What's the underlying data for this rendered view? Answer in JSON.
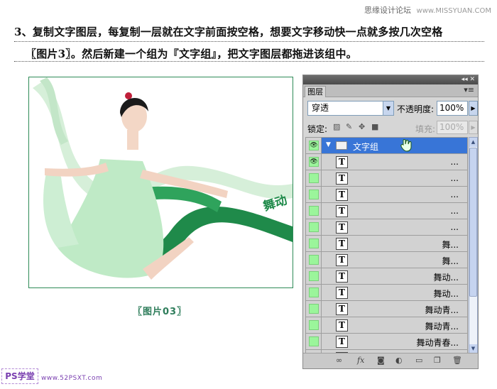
{
  "watermark": {
    "text": "思缘设计论坛",
    "site": "www.MISSYUAN.COM"
  },
  "instruction": {
    "line1": "3、复制文字图层，每复制一层就在文字前面按空格，想要文字移动快一点就多按几次空格",
    "line2": "〖图片3〗。然后新建一个组为『文字组』，把文字图层都拖进该组中。"
  },
  "photo": {
    "artwork_text": "舞动",
    "caption": "〖图片03〗"
  },
  "panel": {
    "tab": "图层",
    "blend_mode": "穿透",
    "opacity_label": "不透明度:",
    "opacity_value": "100%",
    "lock_label": "锁定:",
    "fill_label": "填充:",
    "fill_value": "100%",
    "group": {
      "name": "文字组",
      "visible": true
    },
    "layers": [
      {
        "name": "...",
        "visible": true
      },
      {
        "name": "...",
        "visible": false
      },
      {
        "name": "...",
        "visible": false
      },
      {
        "name": "...",
        "visible": false
      },
      {
        "name": "...",
        "visible": false
      },
      {
        "name": "舞...",
        "visible": false
      },
      {
        "name": "舞...",
        "visible": false
      },
      {
        "name": "舞动...",
        "visible": false
      },
      {
        "name": "舞动...",
        "visible": false
      },
      {
        "name": "舞动青...",
        "visible": false
      },
      {
        "name": "舞动青...",
        "visible": false
      },
      {
        "name": "舞动青春...",
        "visible": false
      },
      {
        "name": "舞动青春",
        "visible": false
      }
    ],
    "colors": {
      "selected": "#3875d7",
      "visibility_swatch": "#9bf59b"
    }
  },
  "footer_logo": {
    "left": "PS学堂",
    "right": "www.52PSXT.com"
  }
}
